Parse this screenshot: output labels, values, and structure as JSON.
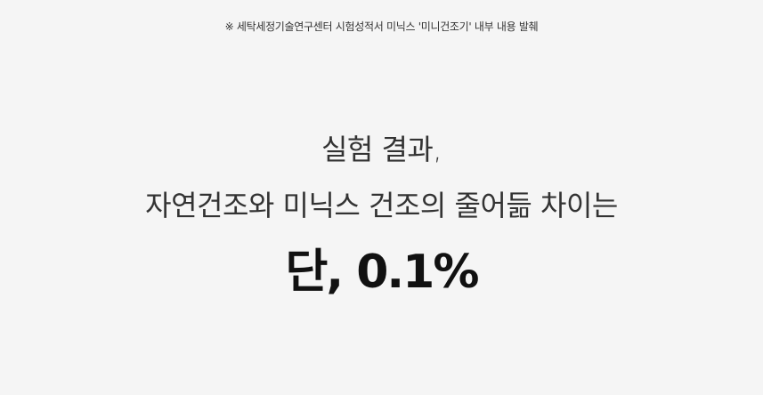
{
  "footnote": "※ 세탁세정기술연구센터 시험성적서 미닉스 '미니건조기' 내부 내용 발췌",
  "headline": {
    "line1": "실험 결과,",
    "line2": "자연건조와 미닉스 건조의 줄어듦 차이는",
    "result": "단, 0.1%"
  }
}
